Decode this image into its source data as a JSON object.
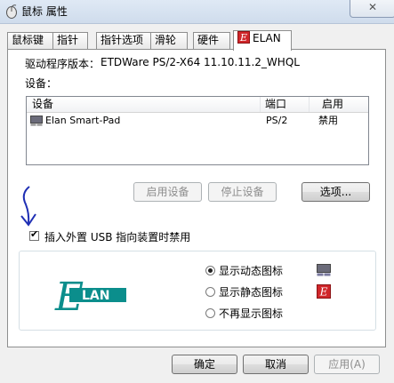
{
  "window": {
    "title": "鼠标 属性",
    "close_label": "✕"
  },
  "tabs": [
    {
      "label": "鼠标键"
    },
    {
      "label": "指针"
    },
    {
      "label": "指针选项"
    },
    {
      "label": "滑轮"
    },
    {
      "label": "硬件"
    },
    {
      "label": "ELAN",
      "active": true
    }
  ],
  "driver": {
    "label": "驱动程序版本：",
    "value": "ETDWare PS/2-X64 11.10.11.2_WHQL"
  },
  "devices": {
    "label": "设备：",
    "columns": [
      "设备",
      "端口",
      "启用"
    ],
    "rows": [
      {
        "name": "Elan Smart-Pad",
        "port": "PS/2",
        "enabled": "禁用"
      }
    ]
  },
  "buttons": {
    "enable_device": "启用设备",
    "stop_device": "停止设备",
    "options": "选项..."
  },
  "usb_option": {
    "label": "插入外置 USB 指向装置时禁用",
    "checked": true
  },
  "tray_icon": {
    "options": [
      {
        "label": "显示动态图标",
        "selected": true
      },
      {
        "label": "显示静态图标",
        "selected": false
      },
      {
        "label": "不再显示图标",
        "selected": false
      }
    ]
  },
  "footer": {
    "ok": "确定",
    "cancel": "取消",
    "apply": "应用(A)"
  },
  "colors": {
    "elan_brand": "#0b8e8c",
    "elan_red": "#d0262a",
    "annotation_arrow": "#1f2fb4"
  }
}
